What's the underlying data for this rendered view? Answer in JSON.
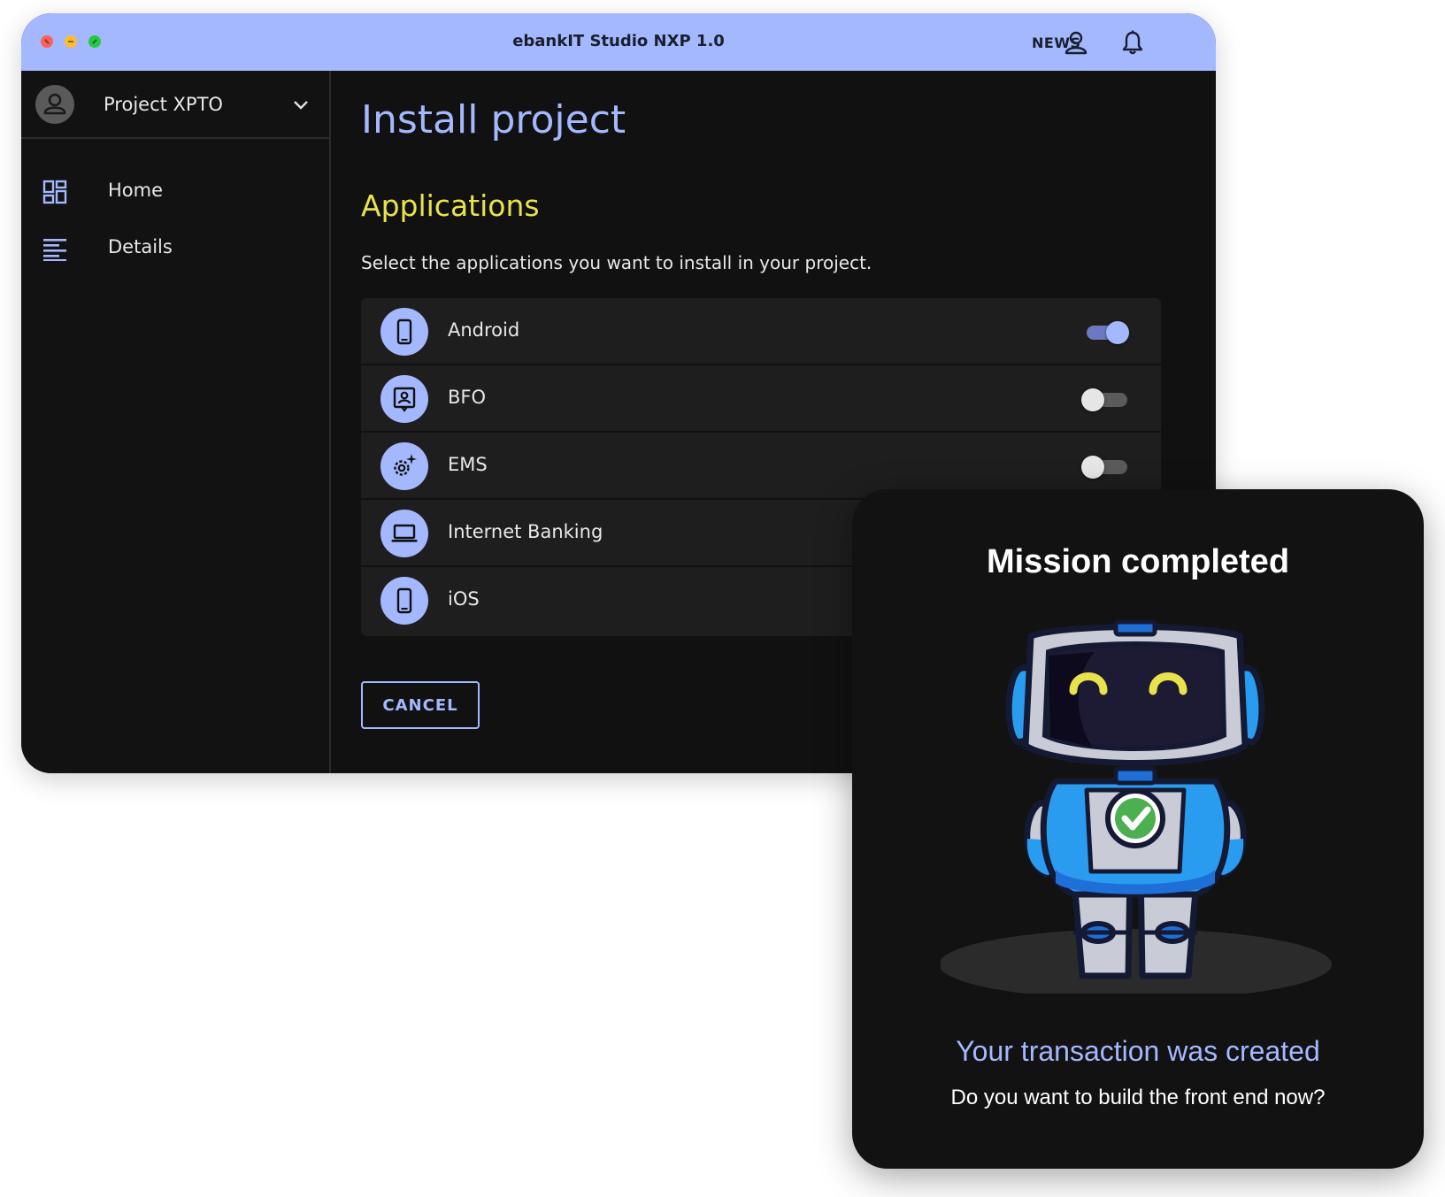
{
  "window": {
    "title": "ebankIT Studio NXP 1.0",
    "news_label": "NEWS",
    "icons": [
      "user-icon",
      "bell-icon"
    ]
  },
  "sidebar": {
    "project_name": "Project XPTO",
    "items": [
      {
        "label": "Home",
        "icon": "dashboard-icon"
      },
      {
        "label": "Details",
        "icon": "list-icon"
      }
    ]
  },
  "main": {
    "page_title": "Install project",
    "section_title": "Applications",
    "section_description": "Select the applications you want to install in your project.",
    "applications": [
      {
        "name": "Android",
        "icon": "smartphone-icon",
        "enabled": true
      },
      {
        "name": "BFO",
        "icon": "contact-card-icon",
        "enabled": false
      },
      {
        "name": "EMS",
        "icon": "settings-sparkle-icon",
        "enabled": false
      },
      {
        "name": "Internet Banking",
        "icon": "laptop-icon",
        "enabled": null
      },
      {
        "name": "iOS",
        "icon": "smartphone-icon",
        "enabled": null
      }
    ],
    "cancel_label": "CANCEL"
  },
  "modal": {
    "title": "Mission completed",
    "subtitle": "Your transaction was created",
    "question": "Do you want to build the front end now?"
  },
  "colors": {
    "accent": "#a4b8ff",
    "section_title": "#e8e34a",
    "background": "#111111"
  }
}
